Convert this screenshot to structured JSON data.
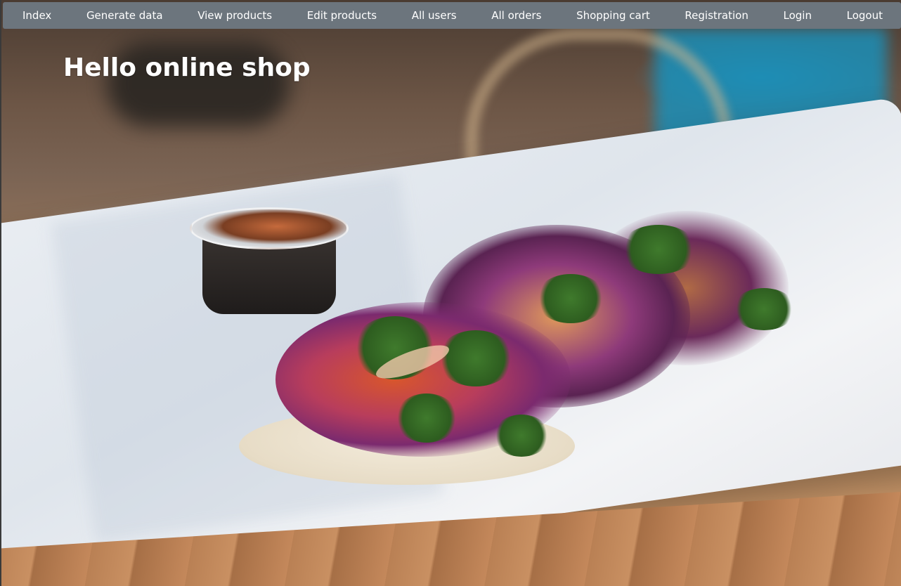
{
  "navbar": {
    "items": [
      {
        "label": "Index"
      },
      {
        "label": "Generate data"
      },
      {
        "label": "View products"
      },
      {
        "label": "Edit products"
      },
      {
        "label": "All users"
      },
      {
        "label": "All orders"
      },
      {
        "label": "Shopping cart"
      },
      {
        "label": "Registration"
      },
      {
        "label": "Login"
      },
      {
        "label": "Logout"
      }
    ],
    "background_color": "#6c757d",
    "text_color": "#ffffff"
  },
  "hero": {
    "title": "Hello online shop",
    "image_subject": "tacos on paper with sauce cup"
  }
}
